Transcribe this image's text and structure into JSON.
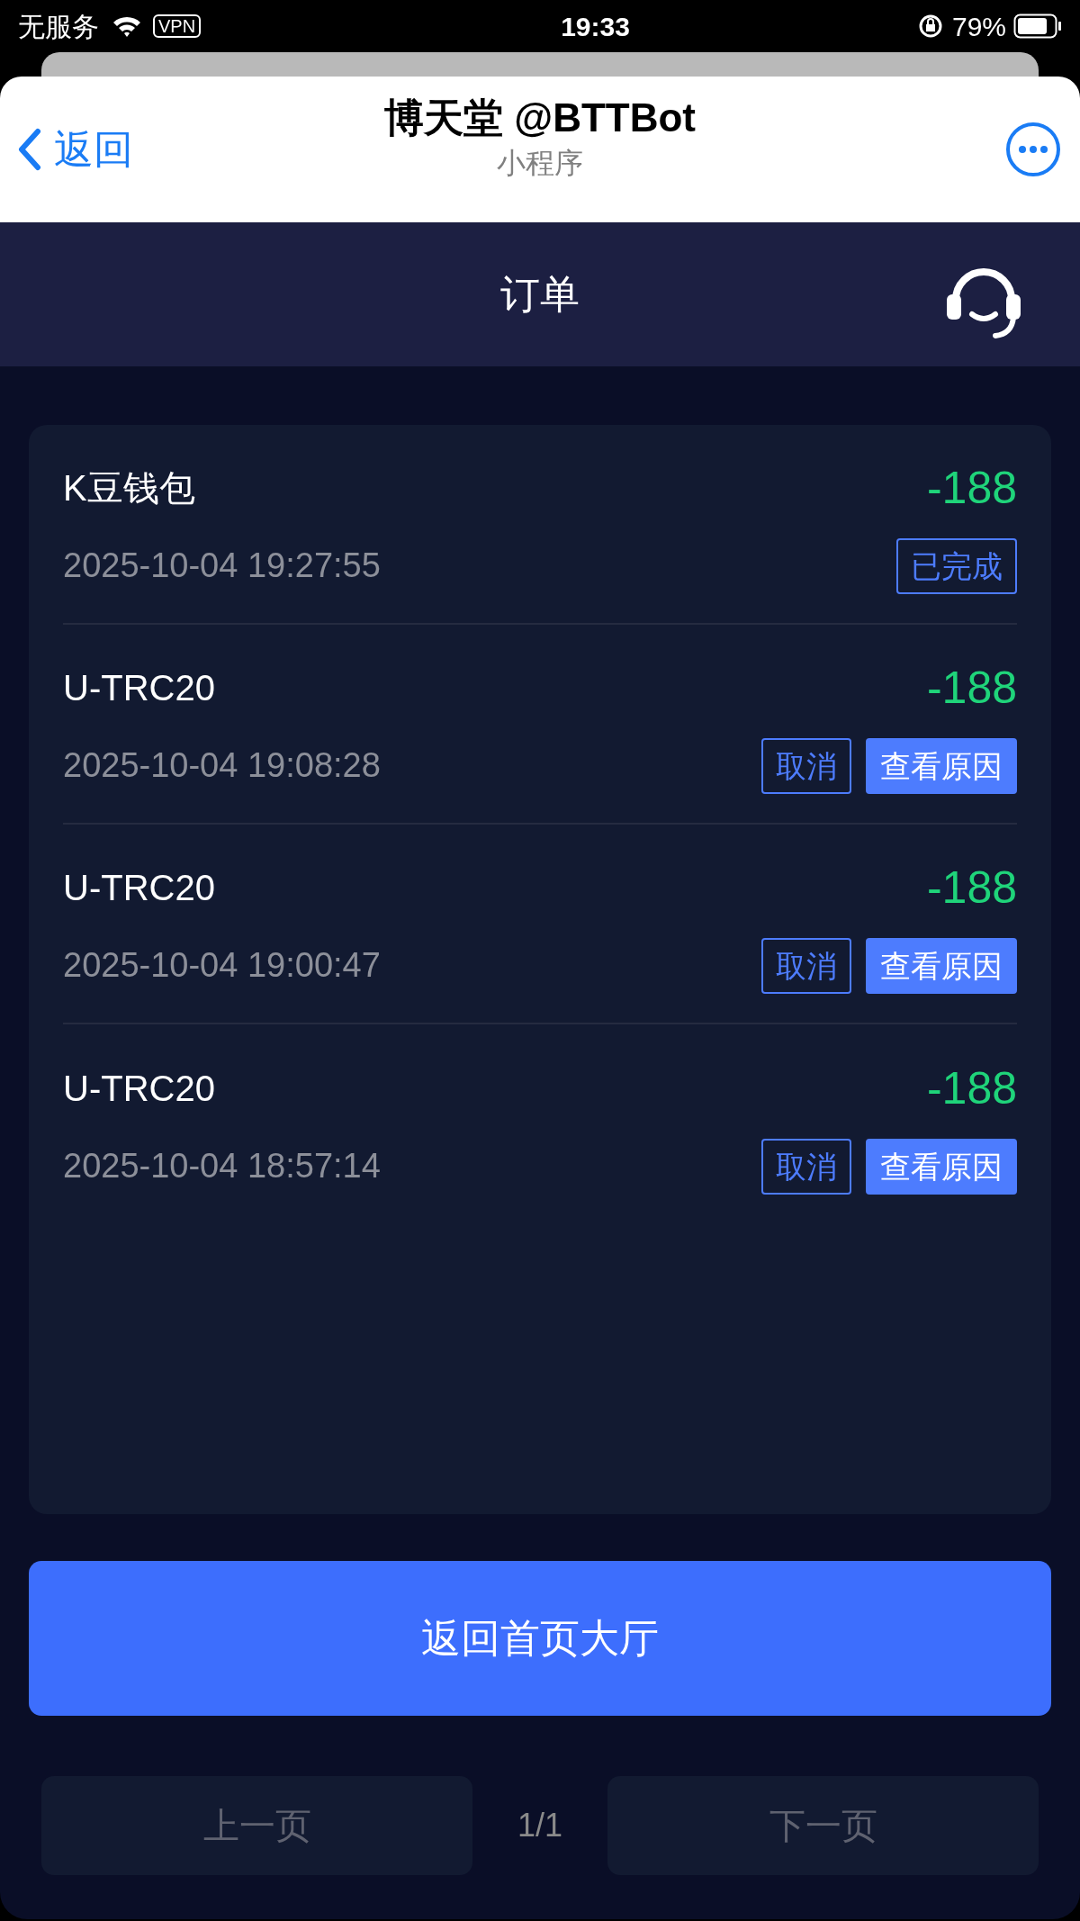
{
  "status_bar": {
    "carrier": "无服务",
    "vpn": "VPN",
    "time": "19:33",
    "battery": "79%"
  },
  "header": {
    "back": "返回",
    "title": "博天堂 @BTTBot",
    "subtitle": "小程序"
  },
  "nav": {
    "title": "订单"
  },
  "orders": [
    {
      "name": "K豆钱包",
      "amount": "-188",
      "time": "2025-10-04 19:27:55",
      "actions": [
        {
          "label": "已完成",
          "kind": "outline"
        }
      ]
    },
    {
      "name": "U-TRC20",
      "amount": "-188",
      "time": "2025-10-04 19:08:28",
      "actions": [
        {
          "label": "取消",
          "kind": "outline"
        },
        {
          "label": "查看原因",
          "kind": "filled"
        }
      ]
    },
    {
      "name": "U-TRC20",
      "amount": "-188",
      "time": "2025-10-04 19:00:47",
      "actions": [
        {
          "label": "取消",
          "kind": "outline"
        },
        {
          "label": "查看原因",
          "kind": "filled"
        }
      ]
    },
    {
      "name": "U-TRC20",
      "amount": "-188",
      "time": "2025-10-04 18:57:14",
      "actions": [
        {
          "label": "取消",
          "kind": "outline"
        },
        {
          "label": "查看原因",
          "kind": "filled"
        }
      ]
    }
  ],
  "home_button": "返回首页大厅",
  "pagination": {
    "prev": "上一页",
    "page": "1/1",
    "next": "下一页",
    "prev_disabled": true,
    "next_disabled": true
  }
}
